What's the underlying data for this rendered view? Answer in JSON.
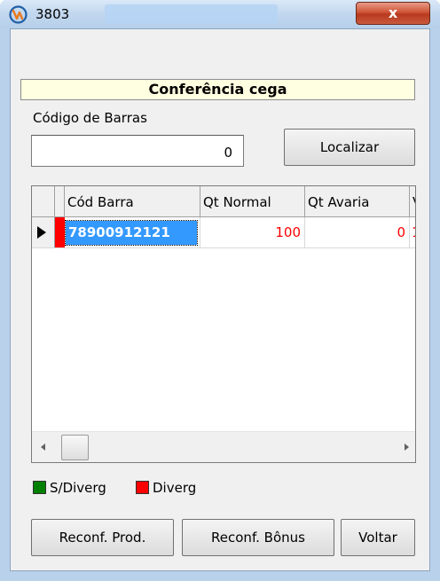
{
  "window": {
    "title": "3803",
    "close_glyph": "x",
    "icon": "app-logo-icon",
    "accent_title": "#b9d1ea"
  },
  "form": {
    "header": "Conferência cega",
    "barcode_label": "Código de Barras",
    "barcode_value": "0",
    "search_button": "Localizar"
  },
  "grid": {
    "columns": [
      "Cód Barra",
      "Qt Normal",
      "Qt Avaria",
      "V"
    ],
    "rows": [
      {
        "cod_barra": "78900912121",
        "qt_normal": "100",
        "qt_avaria": "0",
        "extra": "1",
        "status_color": "#ff0000"
      }
    ]
  },
  "legend": {
    "items": [
      {
        "label": "S/Diverg",
        "color": "#008000"
      },
      {
        "label": "Diverg",
        "color": "#ff0000"
      }
    ]
  },
  "actions": {
    "reconf_prod": "Reconf. Prod.",
    "reconf_bonus": "Reconf. Bônus",
    "voltar": "Voltar"
  }
}
